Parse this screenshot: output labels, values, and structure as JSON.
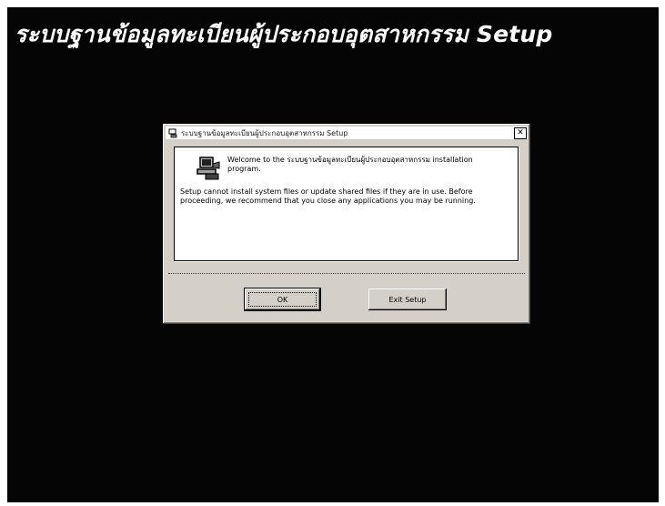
{
  "banner": {
    "title": "ระบบฐานข้อมูลทะเบียนผู้ประกอบอุตสาหกรรม Setup"
  },
  "dialog": {
    "title": "ระบบฐานข้อมูลทะเบียนผู้ประกอบอุตสาหกรรม Setup",
    "close_label": "✕",
    "welcome": "Welcome to the ระบบฐานข้อมูลทะเบียนผู้ประกอบอุตสาหกรรม installation program.",
    "message": "Setup cannot install system files or update shared files if they are in use. Before proceeding, we recommend that you close any applications you may be running.",
    "ok_label": "OK",
    "exit_label": "Exit Setup",
    "icons": [
      "setup-computer-icon",
      "close-icon"
    ]
  }
}
